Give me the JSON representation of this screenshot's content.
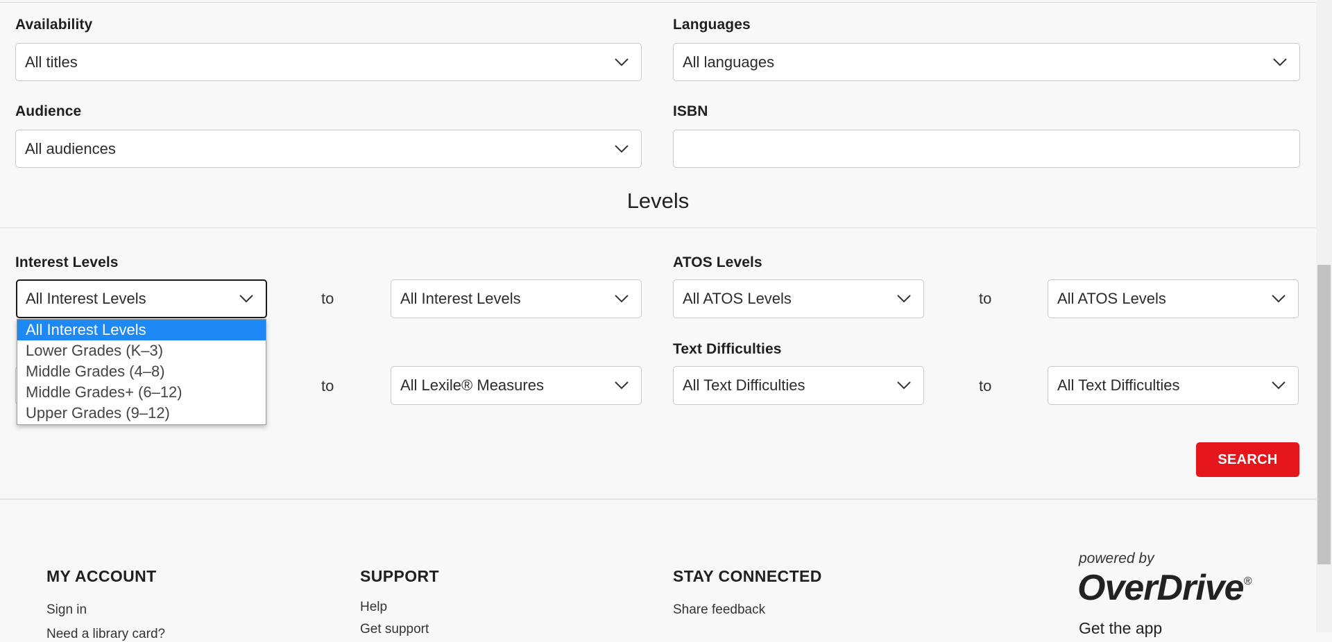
{
  "filters": {
    "availability": {
      "label": "Availability",
      "value": "All titles"
    },
    "languages": {
      "label": "Languages",
      "value": "All languages"
    },
    "audience": {
      "label": "Audience",
      "value": "All audiences"
    },
    "isbn": {
      "label": "ISBN",
      "value": ""
    }
  },
  "levels": {
    "title": "Levels",
    "interest": {
      "label": "Interest Levels",
      "from": "All Interest Levels",
      "to_word": "to",
      "to": "All Interest Levels"
    },
    "atos": {
      "label": "ATOS Levels",
      "from": "All ATOS Levels",
      "to_word": "to",
      "to": "All ATOS Levels"
    },
    "lexile": {
      "to_word": "to",
      "to": "All Lexile® Measures"
    },
    "text_difficulty": {
      "label": "Text Difficulties",
      "from": "All Text Difficulties",
      "to_word": "to",
      "to": "All Text Difficulties"
    },
    "dropdown_options": [
      "All Interest Levels",
      "Lower Grades (K–3)",
      "Middle Grades (4–8)",
      "Middle Grades+ (6–12)",
      "Upper Grades (9–12)"
    ],
    "selected_option": "All Interest Levels"
  },
  "search_button": "SEARCH",
  "footer": {
    "my_account": {
      "heading": "MY ACCOUNT",
      "links": [
        "Sign in",
        "Need a library card?"
      ]
    },
    "support": {
      "heading": "SUPPORT",
      "links": [
        "Help",
        "Get support"
      ]
    },
    "stay_connected": {
      "heading": "STAY CONNECTED",
      "links": [
        "Share feedback"
      ]
    },
    "powered_by": "powered by",
    "logo": "OverDrive",
    "logo_mark": "®",
    "get_app": "Get the app"
  },
  "colors": {
    "accent": "#e3161b",
    "selection": "#1e88f5"
  }
}
